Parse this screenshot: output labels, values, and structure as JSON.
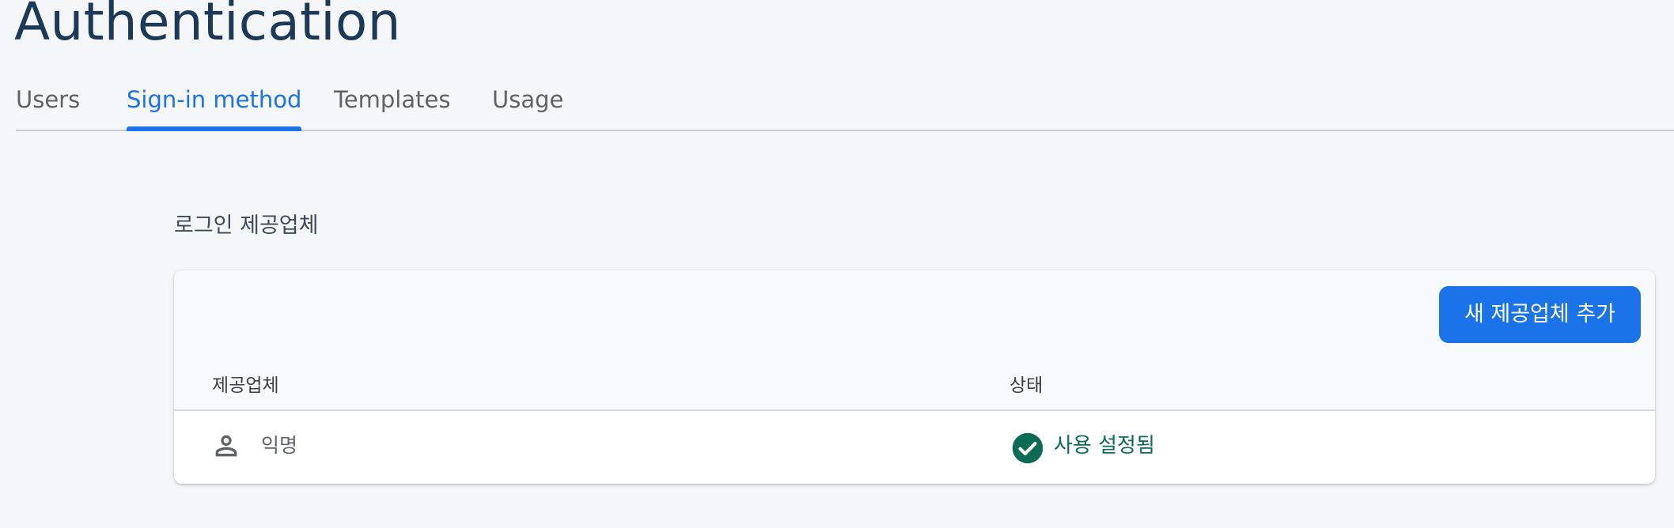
{
  "header": {
    "title": "Authentication"
  },
  "tabs": [
    {
      "label": "Users",
      "active": false
    },
    {
      "label": "Sign-in method",
      "active": true
    },
    {
      "label": "Templates",
      "active": false
    },
    {
      "label": "Usage",
      "active": false
    }
  ],
  "providers_section": {
    "title": "로그인 제공업체",
    "add_button_label": "새 제공업체 추가",
    "columns": [
      "제공업체",
      "상태"
    ],
    "rows": [
      {
        "provider": "익명",
        "provider_icon": "person-outline-icon",
        "status": "사용 설정됨",
        "status_icon": "check-circle-icon"
      }
    ]
  },
  "colors": {
    "accent": "#1a73e8",
    "title": "#1b3a5a",
    "enabled_status": "#0b6b55",
    "background": "#f5f6f8"
  }
}
